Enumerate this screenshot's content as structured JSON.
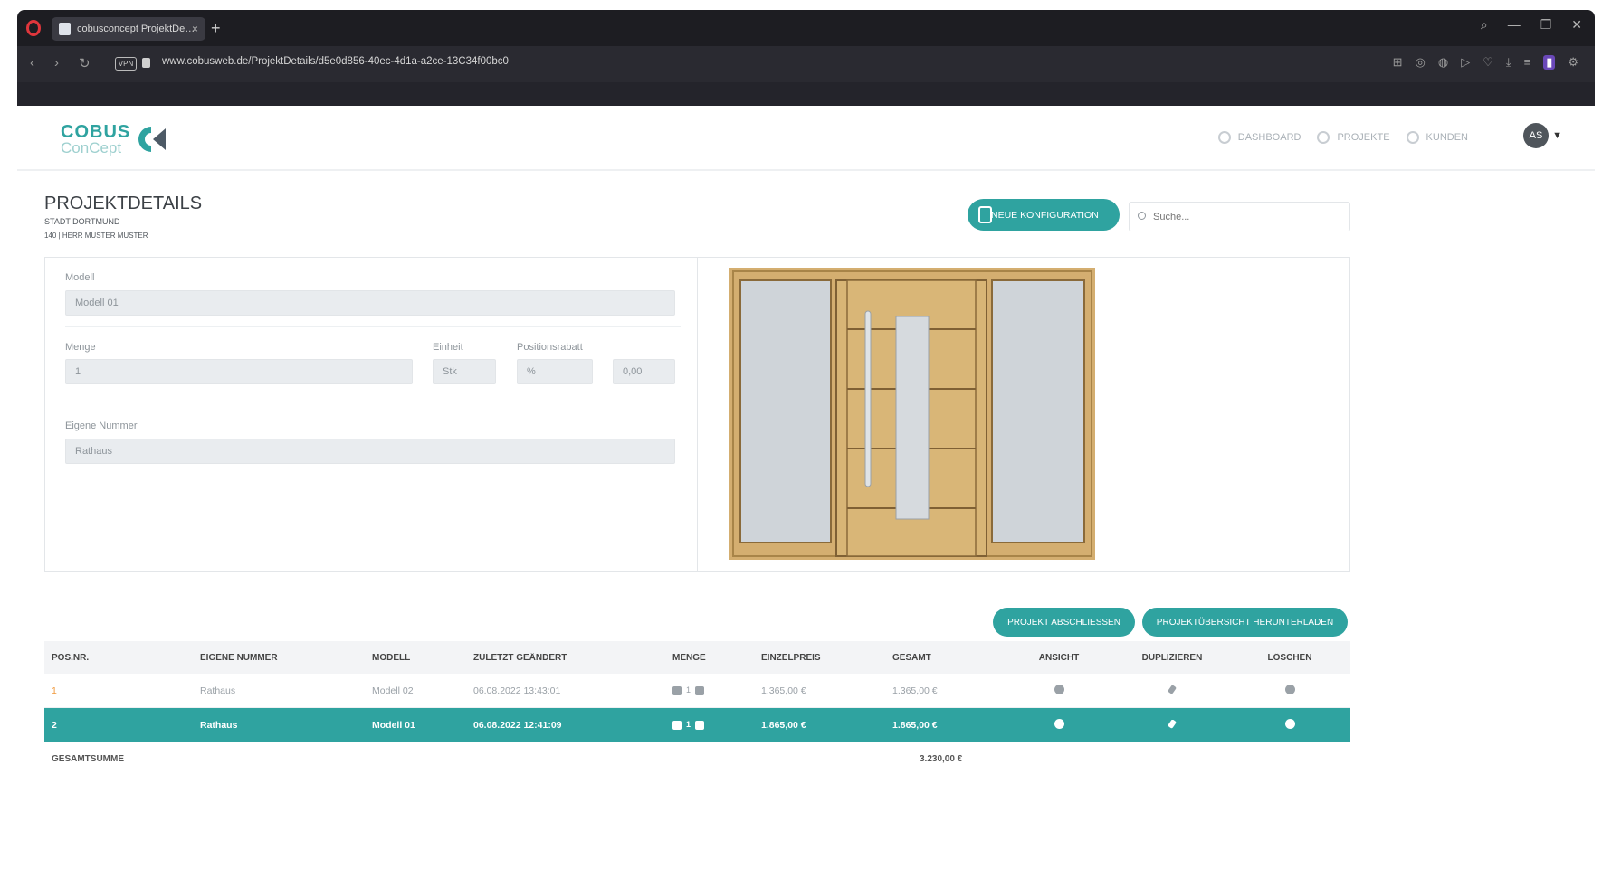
{
  "browser": {
    "tab_title": "cobusconcept ProjektDe…",
    "tab_close": "×",
    "new_tab": "+",
    "url": "www.cobusweb.de/ProjektDetails/d5e0d856-40ec-4d1a-a2ce-13C34f00bc0"
  },
  "header": {
    "logo_top": "COBUS",
    "logo_bottom": "ConCept",
    "nav": [
      {
        "label": "DASHBOARD",
        "icon": "dashboard-icon"
      },
      {
        "label": "PROJEKTE",
        "icon": "projects-icon"
      },
      {
        "label": "KUNDEN",
        "icon": "customers-icon"
      }
    ],
    "avatar": "AS"
  },
  "page": {
    "title": "PROJEKTDETAILS",
    "subtitle1": "STADT DORTMUND",
    "subtitle2": "140 | HERR MUSTER MUSTER",
    "new_config_button": "NEUE KONFIGURATION",
    "search_placeholder": "Suche..."
  },
  "detail": {
    "modell_label": "Modell",
    "modell_value": "Modell 01",
    "menge_label": "Menge",
    "menge_value": "1",
    "einheit_label": "Einheit",
    "einheit_value": "Stk",
    "rabatt_label": "Positionsrabatt",
    "rabatt_unit": "%",
    "rabatt_value": "0,00",
    "eigene_nummer_label": "Eigene Nummer",
    "eigene_nummer_value": "Rathaus"
  },
  "actions": {
    "close_project": "PROJEKT ABSCHLIESSEN",
    "download_overview": "PROJEKTÜBERSICHT HERUNTERLADEN"
  },
  "table": {
    "headers": [
      "POS.NR.",
      "EIGENE NUMMER",
      "MODELL",
      "ZULETZT GEÄNDERT",
      "MENGE",
      "EINZELPREIS",
      "GESAMT",
      "ANSICHT",
      "DUPLIZIEREN",
      "LÖSCHEN"
    ],
    "rows": [
      {
        "pos": "1",
        "eigene_nummer": "Rathaus",
        "modell": "Modell 02",
        "geaendert": "06.08.2022 13:43:01",
        "menge": "1",
        "einzelpreis": "1.365,00 €",
        "gesamt": "1.365,00 €"
      },
      {
        "pos": "2",
        "eigene_nummer": "Rathaus",
        "modell": "Modell 01",
        "geaendert": "06.08.2022 12:41:09",
        "menge": "1",
        "einzelpreis": "1.865,00 €",
        "gesamt": "1.865,00 €"
      }
    ],
    "sum_label": "GESAMTSUMME",
    "sum_value": "3.230,00 €"
  },
  "colors": {
    "accent": "#2fa3a0",
    "pos_highlight": "#f09a3e"
  }
}
